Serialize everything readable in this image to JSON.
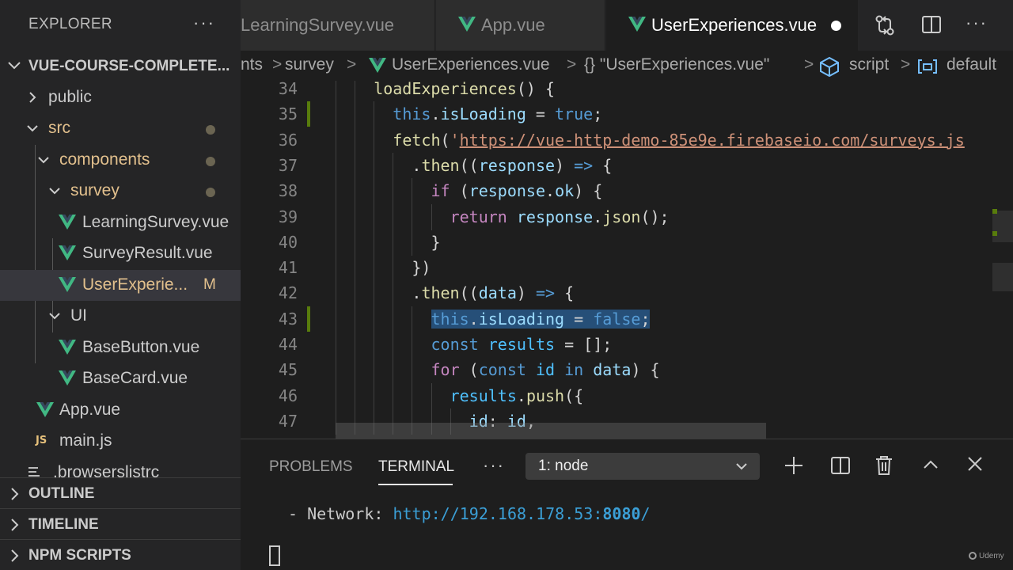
{
  "sidebar": {
    "title": "EXPLORER",
    "more": "···",
    "project": "VUE-COURSE-COMPLETE...",
    "tree": [
      {
        "label": "public"
      },
      {
        "label": "src"
      },
      {
        "label": "components"
      },
      {
        "label": "survey"
      },
      {
        "label": "LearningSurvey.vue"
      },
      {
        "label": "SurveyResult.vue"
      },
      {
        "label": "UserExperie...",
        "badge": "M"
      },
      {
        "label": "UI"
      },
      {
        "label": "BaseButton.vue"
      },
      {
        "label": "BaseCard.vue"
      },
      {
        "label": "App.vue"
      },
      {
        "label": "main.js",
        "icon_text": "JS"
      },
      {
        "label": ".browserslistrc"
      }
    ],
    "sections": [
      "OUTLINE",
      "TIMELINE",
      "NPM SCRIPTS"
    ]
  },
  "tabs": [
    {
      "label": "LearningSurvey.vue"
    },
    {
      "label": "App.vue"
    },
    {
      "label": "UserExperiences.vue",
      "active": true,
      "dirty": true
    }
  ],
  "top_actions": [
    "compare-changes-icon",
    "split-editor-icon",
    "more-actions-icon"
  ],
  "top_more": "···",
  "breadcrumb": {
    "items": [
      "nts",
      "survey",
      "UserExperiences.vue",
      "{} \"UserExperiences.vue\"",
      "script",
      "default"
    ],
    "separator": ">"
  },
  "editor": {
    "lines": [
      {
        "n": "34",
        "indent": 2,
        "tokens": [
          [
            "fn",
            "loadExperiences"
          ],
          [
            "pun",
            "() {"
          ]
        ]
      },
      {
        "n": "35",
        "indent": 3,
        "tokens": [
          [
            "kw",
            "this"
          ],
          [
            "pun",
            "."
          ],
          [
            "var",
            "isLoading"
          ],
          [
            "pun",
            " = "
          ],
          [
            "kw",
            "true"
          ],
          [
            "pun",
            ";"
          ]
        ],
        "modified": true
      },
      {
        "n": "36",
        "indent": 3,
        "tokens": [
          [
            "fn",
            "fetch"
          ],
          [
            "pun",
            "("
          ],
          [
            "str",
            "'"
          ],
          [
            "url",
            "https://vue-http-demo-85e9e.firebaseio.com/surveys.js"
          ]
        ]
      },
      {
        "n": "37",
        "indent": 4,
        "tokens": [
          [
            "pun",
            "."
          ],
          [
            "fn",
            "then"
          ],
          [
            "pun",
            "(("
          ],
          [
            "var",
            "response"
          ],
          [
            "pun",
            ") "
          ],
          [
            "kw",
            "=>"
          ],
          [
            "pun",
            " {"
          ]
        ]
      },
      {
        "n": "38",
        "indent": 5,
        "tokens": [
          [
            "ctl",
            "if"
          ],
          [
            "pun",
            " ("
          ],
          [
            "var",
            "response"
          ],
          [
            "pun",
            "."
          ],
          [
            "var",
            "ok"
          ],
          [
            "pun",
            ") {"
          ]
        ]
      },
      {
        "n": "39",
        "indent": 6,
        "tokens": [
          [
            "ctl",
            "return"
          ],
          [
            "pun",
            " "
          ],
          [
            "var",
            "response"
          ],
          [
            "pun",
            "."
          ],
          [
            "fn",
            "json"
          ],
          [
            "pun",
            "();"
          ]
        ]
      },
      {
        "n": "40",
        "indent": 5,
        "tokens": [
          [
            "pun",
            "}"
          ]
        ]
      },
      {
        "n": "41",
        "indent": 4,
        "tokens": [
          [
            "pun",
            "})"
          ]
        ]
      },
      {
        "n": "42",
        "indent": 4,
        "tokens": [
          [
            "pun",
            "."
          ],
          [
            "fn",
            "then"
          ],
          [
            "pun",
            "(("
          ],
          [
            "var",
            "data"
          ],
          [
            "pun",
            ") "
          ],
          [
            "kw",
            "=>"
          ],
          [
            "pun",
            " {"
          ]
        ]
      },
      {
        "n": "43",
        "indent": 5,
        "tokens": [
          [
            "kw",
            "this"
          ],
          [
            "pun",
            "."
          ],
          [
            "var",
            "isLoading"
          ],
          [
            "pun",
            " = "
          ],
          [
            "kw",
            "false"
          ],
          [
            "pun",
            ";"
          ]
        ],
        "selected": true,
        "modified": true
      },
      {
        "n": "44",
        "indent": 5,
        "tokens": [
          [
            "kw",
            "const"
          ],
          [
            "pun",
            " "
          ],
          [
            "obj",
            "results"
          ],
          [
            "pun",
            " = [];"
          ]
        ]
      },
      {
        "n": "45",
        "indent": 5,
        "tokens": [
          [
            "ctl",
            "for"
          ],
          [
            "pun",
            " ("
          ],
          [
            "kw",
            "const"
          ],
          [
            "pun",
            " "
          ],
          [
            "obj",
            "id"
          ],
          [
            "pun",
            " "
          ],
          [
            "kw",
            "in"
          ],
          [
            "pun",
            " "
          ],
          [
            "var",
            "data"
          ],
          [
            "pun",
            ") {"
          ]
        ]
      },
      {
        "n": "46",
        "indent": 6,
        "tokens": [
          [
            "obj",
            "results"
          ],
          [
            "pun",
            "."
          ],
          [
            "fn",
            "push"
          ],
          [
            "pun",
            "({"
          ]
        ]
      },
      {
        "n": "47",
        "indent": 7,
        "tokens": [
          [
            "var",
            "id"
          ],
          [
            "pun",
            ": "
          ],
          [
            "var",
            "id"
          ],
          [
            "pun",
            ","
          ]
        ]
      }
    ]
  },
  "panel": {
    "tabs": [
      "PROBLEMS",
      "TERMINAL"
    ],
    "active_tab": "TERMINAL",
    "more": "···",
    "terminal_select": "1: node",
    "terminal_line_prefix": "- Network: ",
    "terminal_url": "http://192.168.178.53:",
    "terminal_port": "8080",
    "terminal_url_end": "/",
    "actions": [
      "add-icon",
      "split-terminal-icon",
      "trash-icon",
      "chevron-up-icon",
      "close-icon"
    ]
  },
  "watermark": "Udemy",
  "colors": {
    "vue_green": "#41b883",
    "vue_dark": "#35495e",
    "modified": "#e2c08d",
    "gutter_added": "#587c0c",
    "selection": "#264f78"
  }
}
